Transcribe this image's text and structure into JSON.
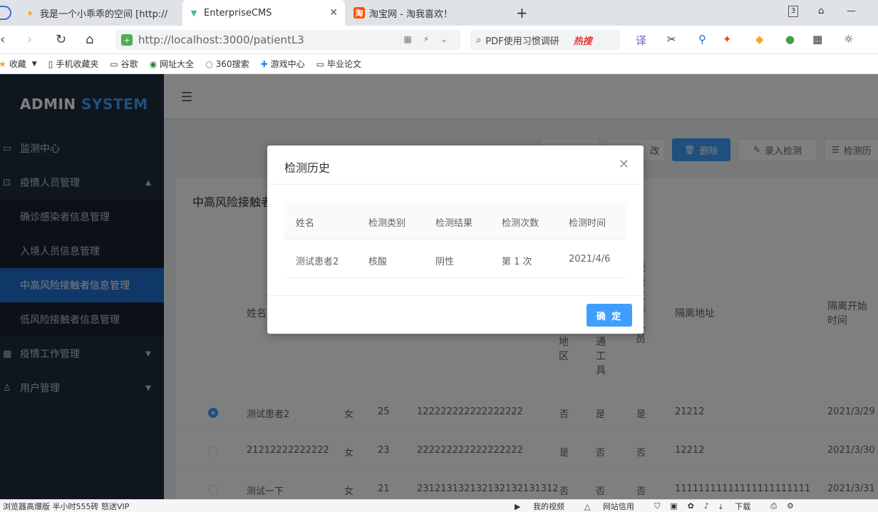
{
  "browser": {
    "tabs": [
      {
        "label": "我是一个小乖乖的空间 [http://",
        "favicon": "star-icon"
      },
      {
        "label": "EnterpriseCMS",
        "favicon": "vue-icon",
        "active": true
      },
      {
        "label": "淘宝网 - 淘我喜欢！",
        "favicon": "taobao-icon"
      }
    ],
    "tab_count": "3",
    "url": "http://localhost:3000/patientL3",
    "search_text": "PDF使用习惯调研",
    "search_hot": "热搜",
    "bookmarks": [
      "收藏",
      "手机收藏夹",
      "谷歌",
      "网址大全",
      "360搜索",
      "游戏中心",
      "毕业论文"
    ]
  },
  "app": {
    "logo_main": "ADMIN",
    "logo_accent": "SYSTEM",
    "menu": [
      {
        "label": "监测中心",
        "icon": "monitor-icon"
      },
      {
        "label": "疫情人员管理",
        "icon": "lock-icon",
        "expanded": true
      },
      {
        "label": "确诊感染者信息管理"
      },
      {
        "label": "入境人员信息管理"
      },
      {
        "label": "中高风险接触者信息管理",
        "active": true
      },
      {
        "label": "低风险接触者信息管理"
      },
      {
        "label": "疫情工作管理",
        "icon": "table-icon"
      },
      {
        "label": "用户管理",
        "icon": "user-icon"
      }
    ]
  },
  "toolbar": {
    "edit_label": "改",
    "delete_label": "删除",
    "enter_label": "录入检测",
    "history_label": "检测历"
  },
  "card": {
    "title": "中高风险接触者",
    "columns": {
      "name": "姓名",
      "region_tail": [
        "地",
        "区"
      ],
      "transport_tail": [
        "通",
        "工",
        "具"
      ],
      "person_tail": [
        "人",
        "员"
      ],
      "person_head": [
        "是",
        "否",
        "工",
        "作",
        "人",
        "员"
      ],
      "address": "隔离地址",
      "start_time": [
        "隔离开始",
        "时间"
      ]
    },
    "rows": [
      {
        "name": "测试患者2",
        "gender": "女",
        "age": "25",
        "id": "122222222222222222",
        "region": "否",
        "transport": "是",
        "staff": "是",
        "address": "21212",
        "start": "2021/3/29",
        "selected": true
      },
      {
        "name": "21212222222222",
        "gender": "女",
        "age": "23",
        "id": "222222222222222222",
        "region": "是",
        "transport": "否",
        "staff": "否",
        "address": "12212",
        "start": "2021/3/30",
        "selected": false
      },
      {
        "name": "测试一下",
        "gender": "女",
        "age": "21",
        "id": "231213132132132132131312",
        "region": "否",
        "transport": "否",
        "staff": "否",
        "address": "11111111111111111111111",
        "start": "2021/3/31",
        "selected": false
      }
    ]
  },
  "dialog": {
    "title": "检测历史",
    "headers": [
      "姓名",
      "检测类别",
      "检测结果",
      "检测次数",
      "检测时间"
    ],
    "rows": [
      {
        "name": "测试患者2",
        "type": "核酸",
        "result": "阴性",
        "count": "第 1 次",
        "time": "2021/4/6"
      }
    ],
    "ok_label": "确 定"
  },
  "statusbar": {
    "left": "浏览器高爆版 半小时555砖 怒送VIP",
    "items": [
      "我的视频",
      "网站信用",
      "下载"
    ]
  }
}
